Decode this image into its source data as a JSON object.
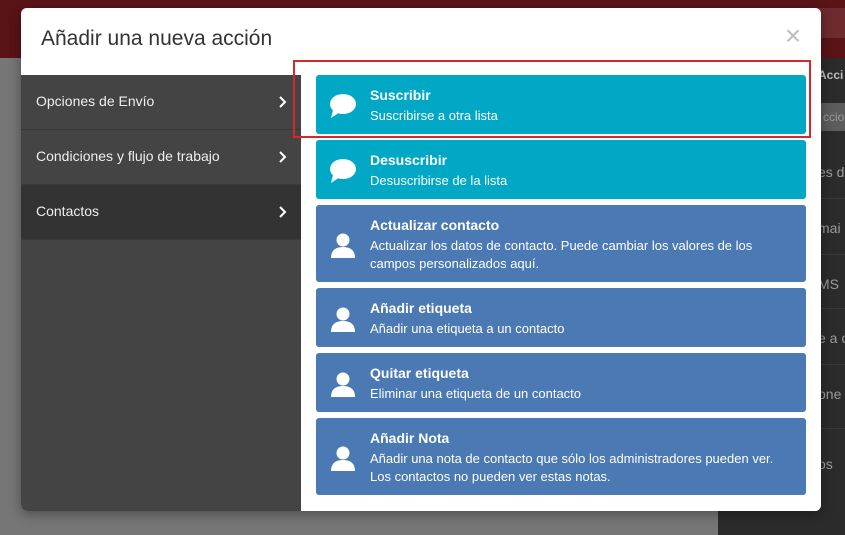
{
  "background": {
    "right_panel": {
      "header": "Acci",
      "input_text": "ccio",
      "items": [
        "es d",
        "mai",
        "MS",
        "e a c",
        "one",
        "os"
      ]
    }
  },
  "modal": {
    "title": "Añadir una nueva acción",
    "close_symbol": "×",
    "sidebar": {
      "items": [
        {
          "label": "Opciones de Envío",
          "icon": "chevron-right-icon",
          "active": false
        },
        {
          "label": "Condiciones y flujo de trabajo",
          "icon": "chevron-right-icon",
          "active": false
        },
        {
          "label": "Contactos",
          "icon": "chevron-right-icon",
          "active": true
        }
      ]
    },
    "actions": [
      {
        "title": "Suscribir",
        "description": "Suscribirse a otra lista",
        "icon": "speech-bubble-icon",
        "color": "#00a8c5",
        "highlighted": true
      },
      {
        "title": "Desuscribir",
        "description": "Desuscribirse de la lista",
        "icon": "speech-bubble-icon",
        "color": "#00a8c5"
      },
      {
        "title": "Actualizar contacto",
        "description": "Actualizar los datos de contacto. Puede cambiar los valores de los campos personalizados aquí.",
        "icon": "user-icon",
        "color": "#4a79b4"
      },
      {
        "title": "Añadir etiqueta",
        "description": "Añadir una etiqueta a un contacto",
        "icon": "user-icon",
        "color": "#4a79b4"
      },
      {
        "title": "Quitar etiqueta",
        "description": "Eliminar una etiqueta de un contacto",
        "icon": "user-icon",
        "color": "#4a79b4"
      },
      {
        "title": "Añadir Nota",
        "description": "Añadir una nota de contacto que sólo los administradores pueden ver. Los contactos no pueden ver estas notas.",
        "icon": "user-icon",
        "color": "#4a79b4"
      }
    ]
  },
  "colors": {
    "teal": "#00a8c5",
    "blue": "#4a79b4",
    "sidebar_bg": "#444444",
    "sidebar_active": "#333333",
    "highlight": "#d8262d"
  }
}
